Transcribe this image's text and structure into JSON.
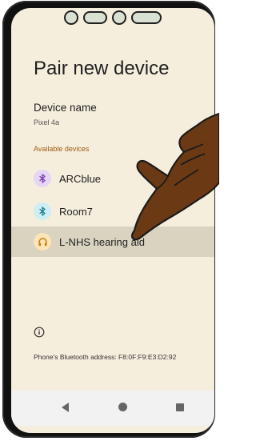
{
  "screen": {
    "title": "Pair new device"
  },
  "device_name": {
    "label": "Device name",
    "value": "Pixel 4a"
  },
  "available_devices": {
    "header": "Available devices",
    "items": [
      {
        "label": "ARCblue",
        "icon": "bluetooth-icon",
        "icon_bg": "#e6d5f5",
        "icon_color": "#7a3fb0"
      },
      {
        "label": "Room7",
        "icon": "bluetooth-icon",
        "icon_bg": "#cdeef3",
        "icon_color": "#1f7f91"
      },
      {
        "label": "L-NHS hearing aid",
        "icon": "headphones-icon",
        "icon_bg": "#fde4b8",
        "icon_color": "#c27a06"
      }
    ]
  },
  "footer": {
    "bt_address": "Phone's Bluetooth address: F8:0F:F9:E3:D2:92"
  },
  "colors": {
    "background": "#f6eedd",
    "section_header": "#9b5a12",
    "selected_row": "#d9d3c0"
  }
}
